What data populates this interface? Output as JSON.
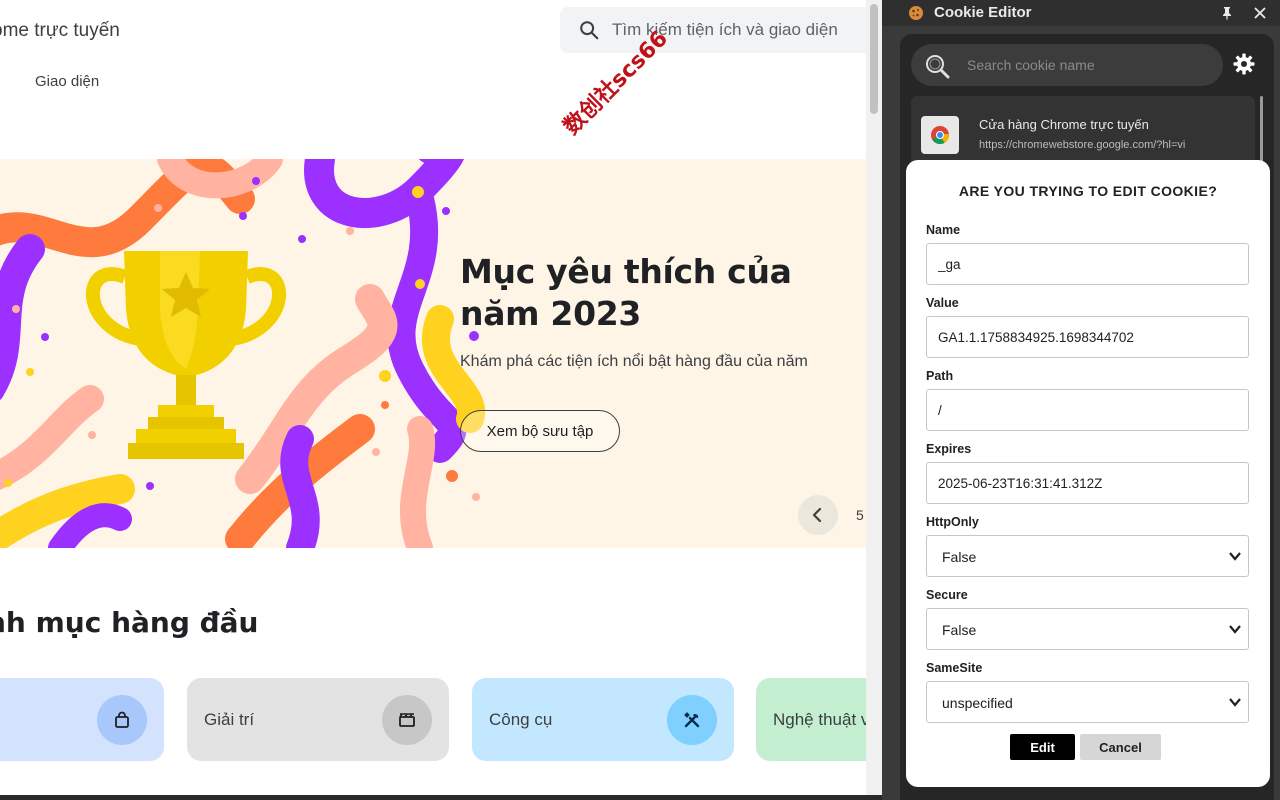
{
  "store": {
    "title": "ome trực tuyến",
    "search_placeholder": "Tìm kiếm tiện ích và giao diện",
    "nav_stub": "ı",
    "nav_themes": "Giao diện",
    "banner": {
      "title": "Mục yêu thích của năm 2023",
      "subtitle": "Khám phá các tiện ích nổi bật hàng đầu của năm",
      "button": "Xem bộ sưu tập",
      "count": "5"
    },
    "section_title": "nh mục hàng đầu",
    "categories": [
      {
        "label": "",
        "icon": "shopping-bag-icon"
      },
      {
        "label": "Giải trí",
        "icon": "clapperboard-icon"
      },
      {
        "label": "Công cụ",
        "icon": "tools-icon"
      },
      {
        "label": "Nghệ thuật v",
        "icon": ""
      }
    ],
    "watermark": "数创社scs66"
  },
  "panel": {
    "title": "Cookie Editor",
    "search_placeholder": "Search cookie name",
    "site": {
      "name": "Cửa hàng Chrome trực tuyến",
      "url": "https://chromewebstore.google.com/?hl=vi"
    }
  },
  "modal": {
    "title": "ARE YOU TRYING TO EDIT COOKIE?",
    "fields": {
      "name": {
        "label": "Name",
        "value": "_ga"
      },
      "value": {
        "label": "Value",
        "value": "GA1.1.1758834925.1698344702"
      },
      "path": {
        "label": "Path",
        "value": "/"
      },
      "expires": {
        "label": "Expires",
        "value": "2025-06-23T16:31:41.312Z"
      },
      "httponly": {
        "label": "HttpOnly",
        "value": "False"
      },
      "secure": {
        "label": "Secure",
        "value": "False"
      },
      "samesite": {
        "label": "SameSite",
        "value": "unspecified"
      }
    },
    "edit_label": "Edit",
    "cancel_label": "Cancel"
  },
  "colors": {
    "banner_bg": "#fef5e6",
    "panel_bg": "#3a3a3a",
    "edit_button": "#000000"
  }
}
